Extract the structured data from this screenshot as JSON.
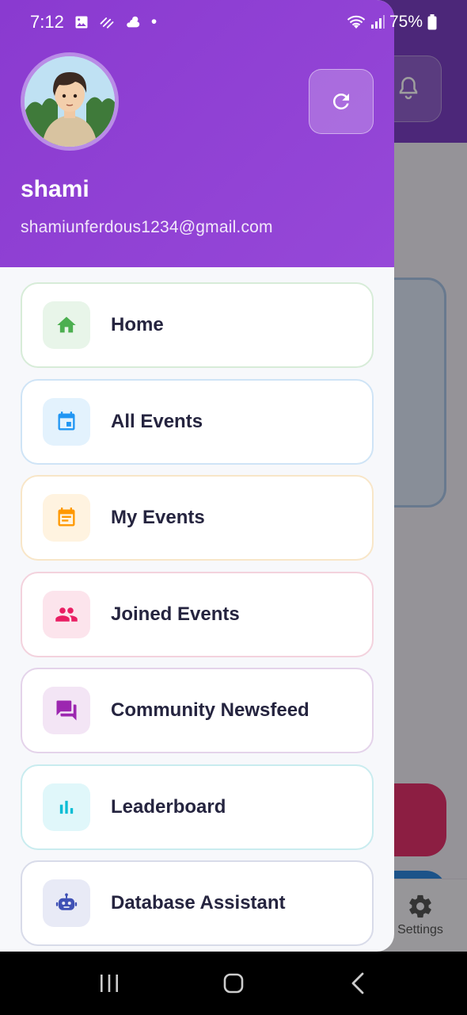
{
  "status_bar": {
    "time": "7:12",
    "battery": "75%",
    "dot": "•"
  },
  "background_app": {
    "bottom_nav": {
      "settings_label": "Settings"
    }
  },
  "drawer": {
    "user": {
      "name": "shami",
      "email": "shamiunferdous1234@gmail.com"
    },
    "menu": [
      {
        "label": "Home",
        "icon": "home-icon",
        "color": "#4caf50",
        "bg": "#e8f5e9",
        "border": "#d7ecd8"
      },
      {
        "label": "All Events",
        "icon": "calendar-icon",
        "color": "#2196f3",
        "bg": "#e3f2fd",
        "border": "#cfe4f6"
      },
      {
        "label": "My Events",
        "icon": "event-note-icon",
        "color": "#ff9800",
        "bg": "#fff3e0",
        "border": "#f8e6c8"
      },
      {
        "label": "Joined Events",
        "icon": "group-icon",
        "color": "#e91e63",
        "bg": "#fce4ec",
        "border": "#f3d2dd"
      },
      {
        "label": "Community Newsfeed",
        "icon": "forum-icon",
        "color": "#9c27b0",
        "bg": "#f3e5f5",
        "border": "#e4d3ea"
      },
      {
        "label": "Leaderboard",
        "icon": "bar-chart-icon",
        "color": "#00bcd4",
        "bg": "#e0f7fa",
        "border": "#c9ecef"
      },
      {
        "label": "Database Assistant",
        "icon": "robot-icon",
        "color": "#3f51b5",
        "bg": "#e8eaf6",
        "border": "#d8dbe9"
      }
    ]
  }
}
